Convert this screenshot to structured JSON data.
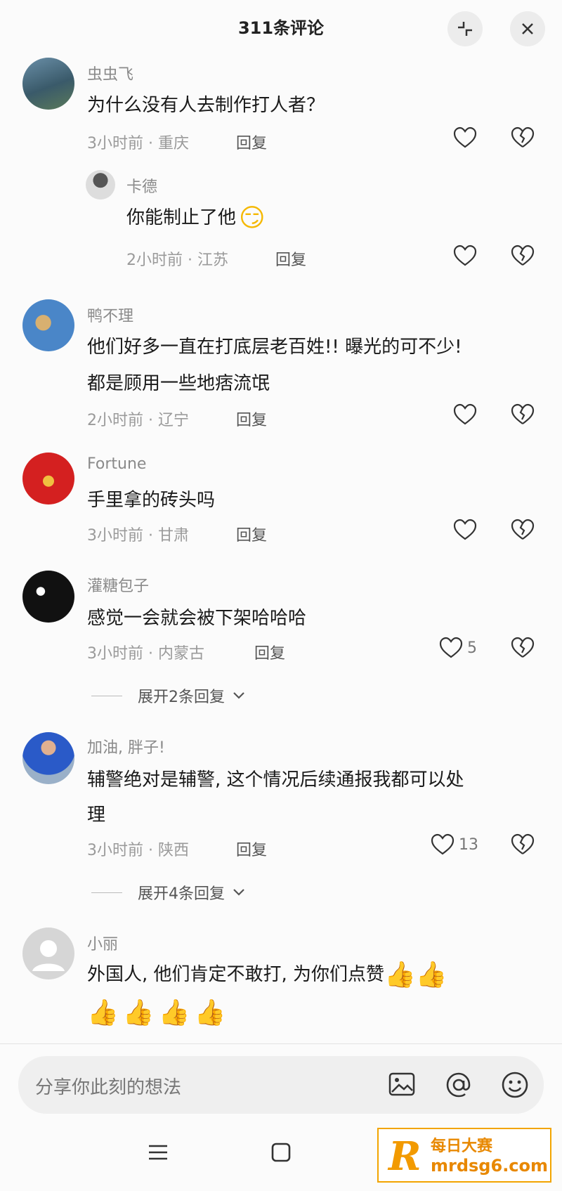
{
  "header": {
    "title": "311条评论",
    "collapse_icon": "collapse-icon",
    "close_icon": "close-icon"
  },
  "comments": [
    {
      "name": "虫虫飞",
      "text": "为什么没有人去制作打人者？",
      "time": "3小时前",
      "location": "重庆",
      "reply": "回复",
      "likes": ""
    },
    {
      "name": "卡德",
      "text": "你能制止了他",
      "emoji": "😏",
      "time": "2小时前",
      "location": "江苏",
      "reply": "回复",
      "likes": ""
    },
    {
      "name": "鸭不理",
      "text_lines": [
        "他们好多一直在打底层老百姓!! 曝光的可不少!",
        "都是顾用一些地痞流氓"
      ],
      "time": "2小时前",
      "location": "辽宁",
      "reply": "回复",
      "likes": ""
    },
    {
      "name": "Fortune",
      "text": "手里拿的砖头吗",
      "time": "3小时前",
      "location": "甘肃",
      "reply": "回复",
      "likes": ""
    },
    {
      "name": "灌糖包子",
      "text": "感觉一会就会被下架哈哈哈",
      "time": "3小时前",
      "location": "内蒙古",
      "reply": "回复",
      "likes": "5",
      "expand": "展开2条回复"
    },
    {
      "name": "加油, 胖子!",
      "text_lines": [
        "辅警绝对是辅警, 这个情况后续通报我都可以处",
        "理"
      ],
      "time": "3小时前",
      "location": "陕西",
      "reply": "回复",
      "likes": "13",
      "expand": "展开4条回复"
    },
    {
      "name": "小丽",
      "text": "外国人, 他们肯定不敢打, 为你们点赞",
      "time": "",
      "location": ""
    }
  ],
  "separator": "·",
  "input": {
    "placeholder": "分享你此刻的想法",
    "icons": [
      "image-icon",
      "at-icon",
      "emoji-icon"
    ]
  },
  "navbar": {
    "icons": [
      "menu-icon",
      "home-square-icon"
    ]
  },
  "watermark": {
    "logo": "R",
    "cn": "每日大赛",
    "url": "mrdsg6.com"
  },
  "colors": {
    "background": "#fbfbfb",
    "text": "#1a1a1a",
    "meta": "#9a9a9a",
    "accent": "#f29a00"
  }
}
